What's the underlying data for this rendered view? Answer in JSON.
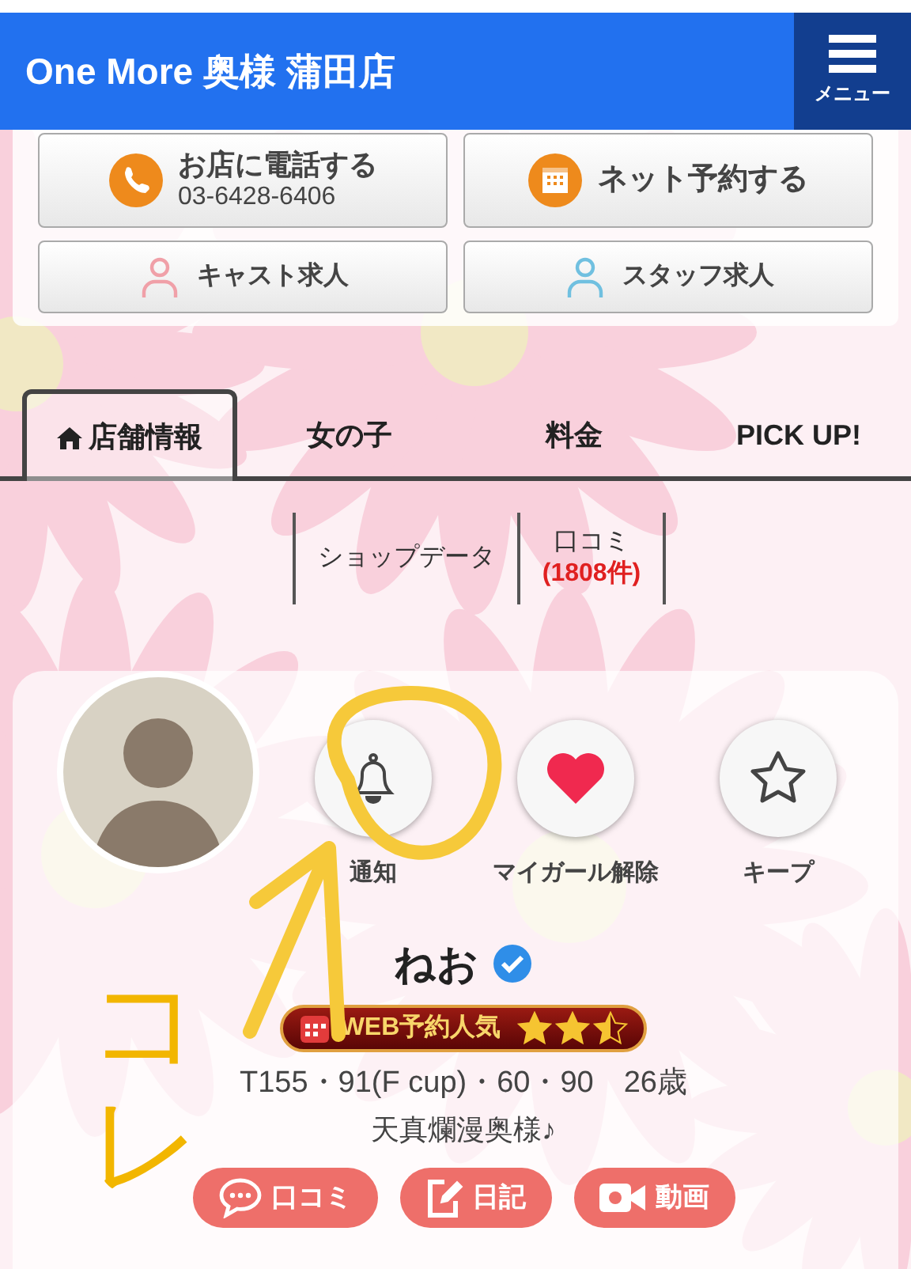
{
  "header": {
    "title": "One More 奥様 蒲田店",
    "menu_label": "メニュー"
  },
  "contact_buttons": [
    {
      "kind": "phone",
      "label": "お店に電話する",
      "sub": "03-6428-6406"
    },
    {
      "kind": "reserve",
      "label": "ネット予約する"
    },
    {
      "kind": "cast",
      "label": "キャスト求人"
    },
    {
      "kind": "staff",
      "label": "スタッフ求人"
    }
  ],
  "tabs": [
    {
      "label": "店舗情報",
      "selected": true
    },
    {
      "label": "女の子",
      "selected": false
    },
    {
      "label": "料金",
      "selected": false
    },
    {
      "label": "PICK UP!",
      "selected": false
    }
  ],
  "subtabs": [
    {
      "label": "ショップデータ"
    },
    {
      "label": "口コミ",
      "count": "(1808件)"
    }
  ],
  "profile": {
    "actions": [
      {
        "kind": "bell",
        "label": "通知"
      },
      {
        "kind": "heart",
        "label": "マイガール解除"
      },
      {
        "kind": "star",
        "label": "キープ"
      }
    ],
    "name": "ねお",
    "verified": true,
    "badge": {
      "label": "WEB予約人気",
      "stars": 2.5
    },
    "stats": "T155・91(F cup)・60・90　26歳",
    "tagline": "天真爛漫奥様♪",
    "links": [
      {
        "kind": "chat",
        "label": "口コミ"
      },
      {
        "kind": "diary",
        "label": "日記"
      },
      {
        "kind": "video",
        "label": "動画"
      }
    ]
  },
  "annotation": {
    "text": "コレ"
  }
}
